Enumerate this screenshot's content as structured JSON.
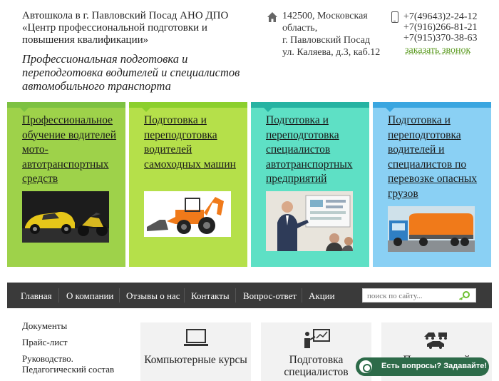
{
  "header": {
    "title": "Автошкола в г. Павловский Посад АНО ДПО «Центр профессиональной подготовки и повышения квалификации»",
    "slogan": "Профессиональная подготовка и переподготовка водителей и специалистов автомобильного транспорта",
    "address_lines": [
      "142500, Московская",
      "область,",
      "г. Павловский Посад",
      "ул. Каляева, д.3, каб.12"
    ],
    "phones": [
      "+7(49643)2-24-12",
      "+7(916)266-81-21",
      "+7(915)370-38-63"
    ],
    "callback_label": "заказать звонок"
  },
  "cards": [
    {
      "label": "Профессиональное обучение водителей мото-автотранспортных средств",
      "color": "#7dc142",
      "bg": "#9ed24a",
      "icon": "sports-car-motorcycle-photo"
    },
    {
      "label": "Подготовка и переподготовка водителей самоходных машин",
      "color": "#8ccf2d",
      "bg": "#b5e04a",
      "icon": "backhoe-loader-photo"
    },
    {
      "label": "Подготовка и переподготовка специалистов автотранспортных предприятий",
      "color": "#26b3a2",
      "bg": "#5ee0c5",
      "icon": "lecture-photo"
    },
    {
      "label": "Подготовка и переподготовка водителей и специалистов по перевозке опасных грузов",
      "color": "#3aa6e0",
      "bg": "#8ad0f4",
      "icon": "tanker-truck-photo"
    }
  ],
  "nav": {
    "items": [
      "Главная",
      "О компании",
      "Отзывы о нас",
      "Контакты",
      "Вопрос-ответ",
      "Акции"
    ],
    "search_placeholder": "поиск по сайту..."
  },
  "sidebar": {
    "links": [
      "Документы",
      "Прайс-лист",
      "Руководство. Педагогический состав"
    ]
  },
  "tiles": [
    {
      "title": "Компьютерные курсы",
      "icon": "laptop-icon"
    },
    {
      "title": "Подготовка специалистов",
      "icon": "presenter-icon"
    },
    {
      "title": "П... водителей",
      "icon": "vehicles-icon"
    }
  ],
  "chat": {
    "label": "Есть вопросы? Задавайте!"
  }
}
